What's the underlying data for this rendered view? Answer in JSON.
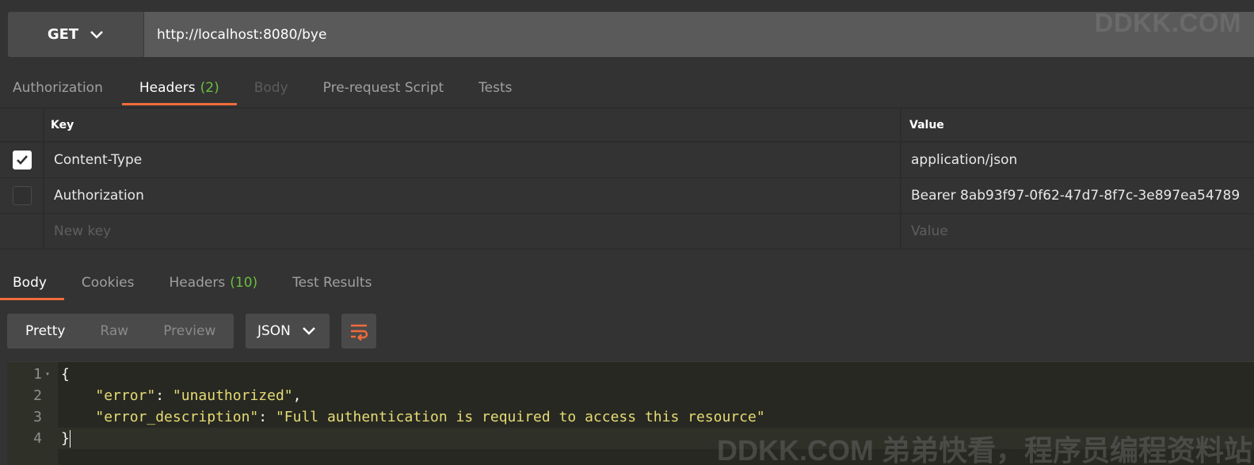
{
  "request": {
    "method": "GET",
    "url": "http://localhost:8080/bye"
  },
  "watermark": {
    "top": "DDKK.COM",
    "bottom": "DDKK.COM 弟弟快看，程序员编程资料站"
  },
  "request_tabs": [
    {
      "label": "Authorization",
      "count": ""
    },
    {
      "label": "Headers",
      "count": "(2)"
    },
    {
      "label": "Body",
      "count": ""
    },
    {
      "label": "Pre-request Script",
      "count": ""
    },
    {
      "label": "Tests",
      "count": ""
    }
  ],
  "headers_table": {
    "columns": {
      "key": "Key",
      "value": "Value"
    },
    "rows": [
      {
        "key": "Content-Type",
        "value": "application/json",
        "checked": true
      },
      {
        "key": "Authorization",
        "value": "Bearer 8ab93f97-0f62-47d7-8f7c-3e897ea54789",
        "checked": false
      }
    ],
    "new_key_placeholder": "New key",
    "new_value_placeholder": "Value"
  },
  "response_tabs": [
    {
      "label": "Body",
      "count": ""
    },
    {
      "label": "Cookies",
      "count": ""
    },
    {
      "label": "Headers",
      "count": "(10)"
    },
    {
      "label": "Test Results",
      "count": ""
    }
  ],
  "view_modes": [
    "Pretty",
    "Raw",
    "Preview"
  ],
  "format": "JSON",
  "editor": {
    "line_numbers": [
      "1",
      "2",
      "3",
      "4"
    ],
    "lines": {
      "l1": "{",
      "l2_key": "\"error\"",
      "l2_sep": ": ",
      "l2_val": "\"unauthorized\"",
      "l2_end": ",",
      "l3_key": "\"error_description\"",
      "l3_sep": ": ",
      "l3_val": "\"Full authentication is required to access this resource\"",
      "l4": "}"
    }
  },
  "colors": {
    "accent": "#f26b3a",
    "count_green": "#6bbf3e",
    "string_yellow": "#e6db74"
  }
}
